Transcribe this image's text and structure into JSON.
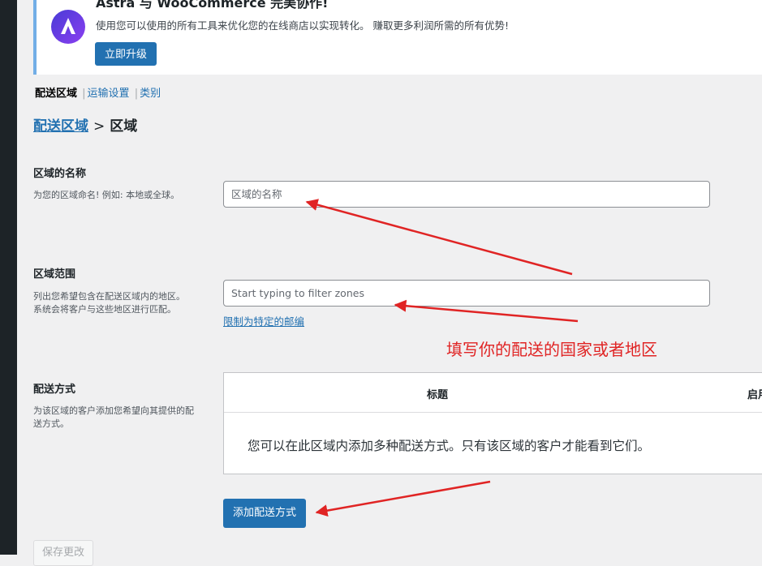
{
  "notice": {
    "title": "Astra 与 WooCommerce 完美协作!",
    "description": "使用您可以使用的所有工具来优化您的在线商店以实现转化。 赚取更多利润所需的所有优势!",
    "upgrade_button": "立即升级",
    "logo_icon": "astra-logo-icon"
  },
  "subnav": {
    "current": "配送区域",
    "items": [
      "运输设置",
      "类别"
    ],
    "separator": "|"
  },
  "breadcrumb": {
    "link": "配送区域",
    "separator": ">",
    "current": "区域"
  },
  "zone_name": {
    "label": "区域的名称",
    "help": "为您的区域命名! 例如: 本地或全球。",
    "placeholder": "区域的名称"
  },
  "zone_regions": {
    "label": "区域范围",
    "help": "列出您希望包含在配送区域内的地区。 系统会将客户与这些地区进行匹配。",
    "placeholder": "Start typing to filter zones",
    "postcode_link": "限制为特定的邮编"
  },
  "annotation": "填写你的配送的国家或者地区",
  "shipping_methods": {
    "label": "配送方式",
    "help": "为该区域的客户添加您希望向其提供的配送方式。",
    "columns": [
      "标题",
      "启用"
    ],
    "empty_message": "您可以在此区域内添加多种配送方式。只有该区域的客户才能看到它们。",
    "add_button": "添加配送方式"
  },
  "save_button": "保存更改",
  "colors": {
    "primary": "#2271b1",
    "annotation_red": "#e02424",
    "notice_border": "#72aee6",
    "admin_bar": "#1d2327"
  }
}
